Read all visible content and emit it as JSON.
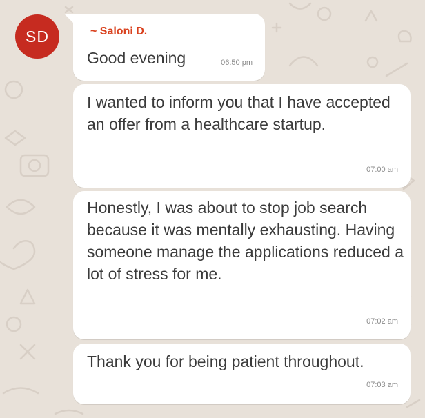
{
  "sender": {
    "name": "~ Saloni D.",
    "initials": "SD",
    "name_color": "#d9411e",
    "avatar_color": "#c62b20"
  },
  "messages": [
    {
      "text": "Good evening",
      "time": "06:50 pm"
    },
    {
      "text": "I wanted to inform you that I have accepted an offer from a healthcare startup.",
      "time": "07:00 am"
    },
    {
      "text": "Honestly, I was about to stop job search because it was mentally exhausting. Having someone manage the applications reduced a lot of stress for me.",
      "time": "07:02 am"
    },
    {
      "text": "Thank you for being patient throughout.",
      "time": "07:03 am"
    }
  ],
  "theme": {
    "wallpaper": "#e8e1d9",
    "bubble": "#ffffff"
  }
}
